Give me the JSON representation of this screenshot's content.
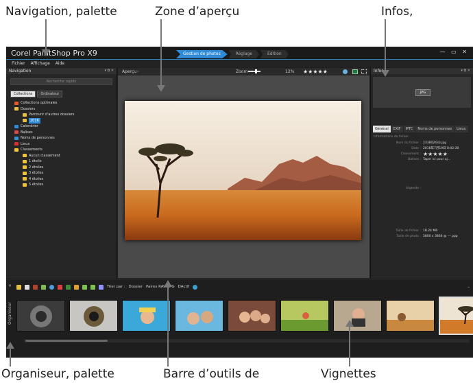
{
  "callouts": {
    "navigation": "Navigation, palette",
    "preview_zone": "Zone d’aperçu",
    "infos": "Infos,",
    "organizer": "Organiseur, palette",
    "toolbar": "Barre d’outils de",
    "thumbnails": "Vignettes"
  },
  "app": {
    "title": "Corel PaintShop Pro X9",
    "modes": [
      "Gestion de photos",
      "Réglage",
      "Édition"
    ],
    "window_controls": "— ▭ ✕"
  },
  "menu": [
    "Fichier",
    "Affichage",
    "Aide"
  ],
  "navigation": {
    "title": "Navigation",
    "search_placeholder": "Recherche rapide",
    "tabs": [
      "Collections",
      "Ordinateur"
    ],
    "tree": [
      {
        "label": "Collections optimales",
        "indent": 1,
        "icon": "collections-icon"
      },
      {
        "label": "Dossiers",
        "indent": 1,
        "icon": "folder-icon"
      },
      {
        "label": "Parcourir d'autres dossiers",
        "indent": 2,
        "icon": "folder-icon"
      },
      {
        "label": "2016",
        "indent": 2,
        "icon": "folder-icon",
        "selected": true
      },
      {
        "label": "Calendrier",
        "indent": 1,
        "icon": "calendar-icon"
      },
      {
        "label": "Balises",
        "indent": 1,
        "icon": "tag-icon"
      },
      {
        "label": "Noms de personnes",
        "indent": 1,
        "icon": "person-icon"
      },
      {
        "label": "Lieux",
        "indent": 1,
        "icon": "map-pin-icon"
      },
      {
        "label": "Classements",
        "indent": 1,
        "icon": "star-icon"
      },
      {
        "label": "Aucun classement",
        "indent": 2,
        "icon": "star-icon"
      },
      {
        "label": "1 étoile",
        "indent": 2,
        "icon": "star-icon"
      },
      {
        "label": "2 étoiles",
        "indent": 2,
        "icon": "star-icon"
      },
      {
        "label": "3 étoiles",
        "indent": 2,
        "icon": "star-icon"
      },
      {
        "label": "4 étoiles",
        "indent": 2,
        "icon": "star-icon"
      },
      {
        "label": "5 étoiles",
        "indent": 2,
        "icon": "star-icon"
      }
    ]
  },
  "preview": {
    "title": "Aperçu",
    "zoom_label": "Zoom",
    "zoom_value": "12%",
    "rating": "★★★★★"
  },
  "info": {
    "title": "Infos",
    "thumb_badge": "JPG",
    "tabs": [
      "Général",
      "EXIF",
      "IPTC",
      "Noms de personnes",
      "Lieux"
    ],
    "section": "Informations de fichier",
    "fields": [
      {
        "label": "Nom du fichier :",
        "value": "233802433.jpg"
      },
      {
        "label": "Date :",
        "value": "2016年7月19日 8:02:30"
      },
      {
        "label": "Classement :",
        "value": "★★★★★"
      },
      {
        "label": "Balises :",
        "value": "Taper ici pour aj..."
      },
      {
        "label": "Légende :",
        "value": ""
      },
      {
        "label": "Taille de fichier :",
        "value": "18.24 MB"
      },
      {
        "label": "Taille de photo :",
        "value": "5800 x 3866 @ --- ppp"
      }
    ]
  },
  "organizer": {
    "side_label": "Organiseur",
    "sort_label": "Trier par :",
    "sort_value": "Dossier",
    "raw_label": "Paires RAW/JPG",
    "active_label": "DActif"
  }
}
